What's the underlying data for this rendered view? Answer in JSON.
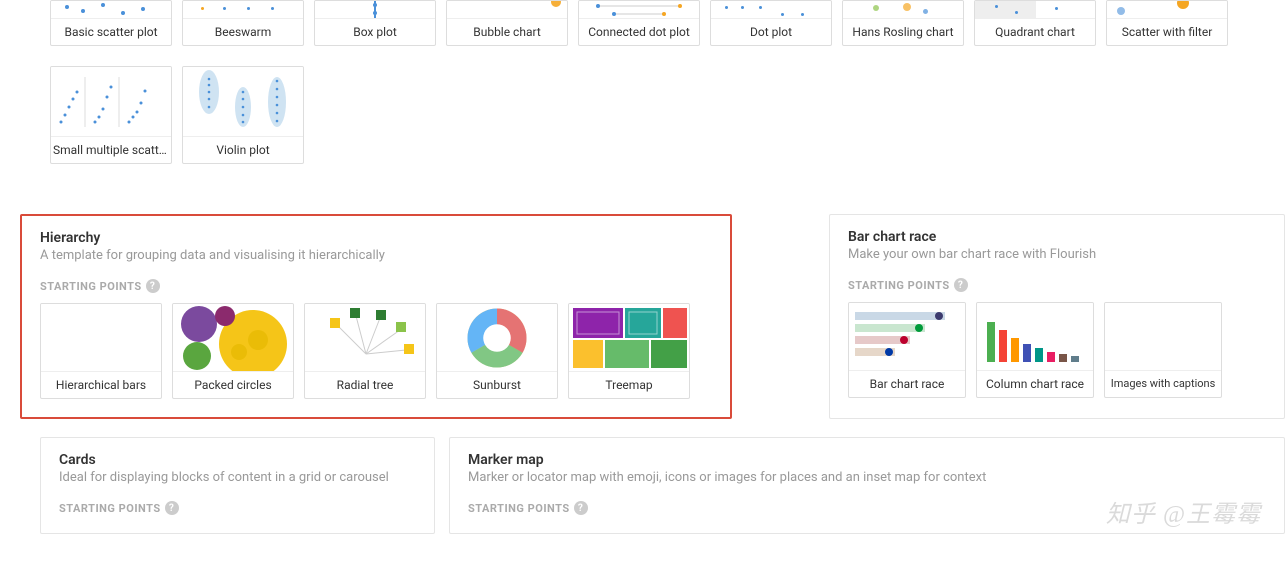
{
  "scatter_row_1": [
    {
      "label": "Basic scatter plot"
    },
    {
      "label": "Beeswarm"
    },
    {
      "label": "Box plot"
    },
    {
      "label": "Bubble chart"
    },
    {
      "label": "Connected dot plot"
    },
    {
      "label": "Dot plot"
    },
    {
      "label": "Hans Rosling chart"
    },
    {
      "label": "Quadrant chart"
    },
    {
      "label": "Scatter with filter"
    }
  ],
  "scatter_row_2": [
    {
      "label": "Small multiple scatter"
    },
    {
      "label": "Violin plot"
    }
  ],
  "sections": {
    "hierarchy": {
      "title": "Hierarchy",
      "desc": "A template for grouping data and visualising it hierarchically",
      "starting_points_label": "STARTING POINTS",
      "items": [
        {
          "label": "Hierarchical bars"
        },
        {
          "label": "Packed circles"
        },
        {
          "label": "Radial tree"
        },
        {
          "label": "Sunburst"
        },
        {
          "label": "Treemap"
        }
      ]
    },
    "barchartrace": {
      "title": "Bar chart race",
      "desc": "Make your own bar chart race with Flourish",
      "starting_points_label": "STARTING POINTS",
      "items": [
        {
          "label": "Bar chart race"
        },
        {
          "label": "Column chart race"
        },
        {
          "label": "Images with captions"
        }
      ]
    },
    "cards": {
      "title": "Cards",
      "desc": "Ideal for displaying blocks of content in a grid or carousel",
      "starting_points_label": "STARTING POINTS"
    },
    "markermap": {
      "title": "Marker map",
      "desc": "Marker or locator map with emoji, icons or images for places and an inset map for context",
      "starting_points_label": "STARTING POINTS"
    }
  },
  "help_glyph": "?",
  "watermark": "知乎  @王霉霉"
}
